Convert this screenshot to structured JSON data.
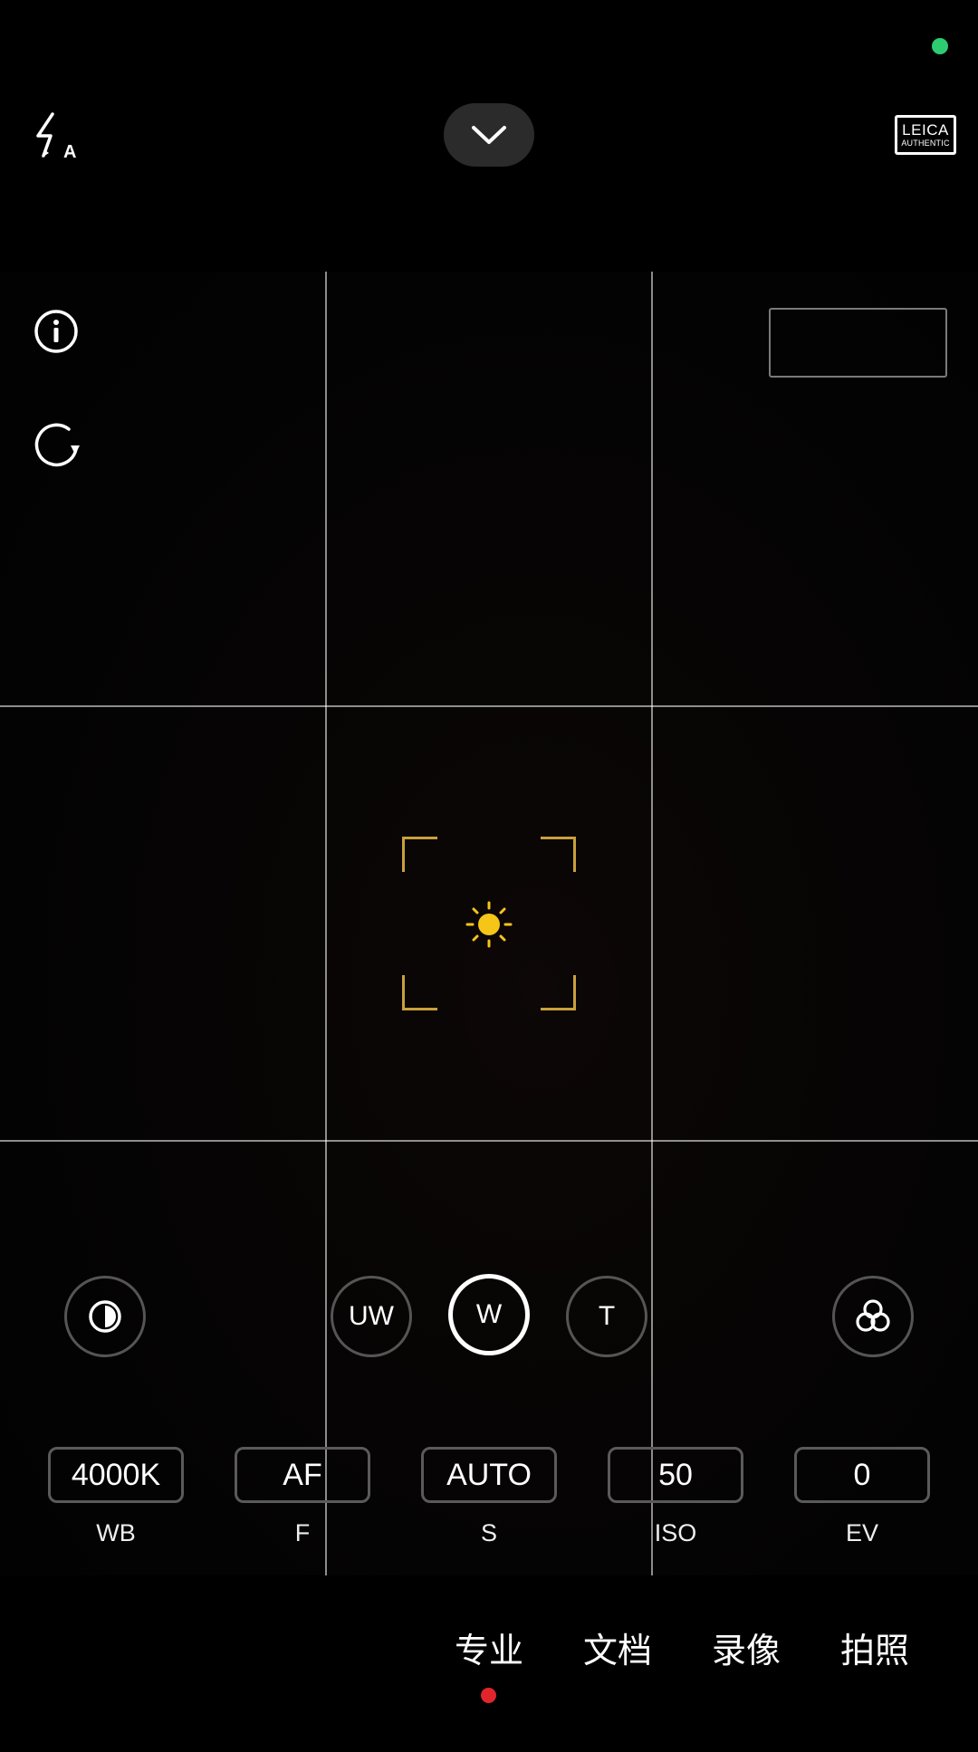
{
  "status": {
    "indicator_color": "#2ecc71"
  },
  "top_bar": {
    "flash_icon": "flash-auto-icon",
    "collapse_icon": "chevron-down-icon",
    "leica": {
      "line1": "LEICA",
      "line2": "AUTHENTIC"
    }
  },
  "left_tools": {
    "info_icon": "info-icon",
    "rotate_icon": "rotate-icon"
  },
  "focus": {
    "icon": "sun-icon",
    "accent_color": "#c9a13b",
    "sun_color": "#f5c518"
  },
  "controls": {
    "contrast_icon": "contrast-icon",
    "filters_icon": "filters-icon",
    "lenses": [
      {
        "label": "UW"
      },
      {
        "label": "W"
      },
      {
        "label": "T"
      }
    ]
  },
  "params": [
    {
      "value": "4000K",
      "label": "WB"
    },
    {
      "value": "AF",
      "label": "F"
    },
    {
      "value": "AUTO",
      "label": "S"
    },
    {
      "value": "50",
      "label": "ISO"
    },
    {
      "value": "0",
      "label": "EV"
    }
  ],
  "modes": [
    {
      "label": "专业"
    },
    {
      "label": "文档"
    },
    {
      "label": "录像"
    },
    {
      "label": "拍照"
    }
  ],
  "mode_indicator_color": "#e0262b"
}
